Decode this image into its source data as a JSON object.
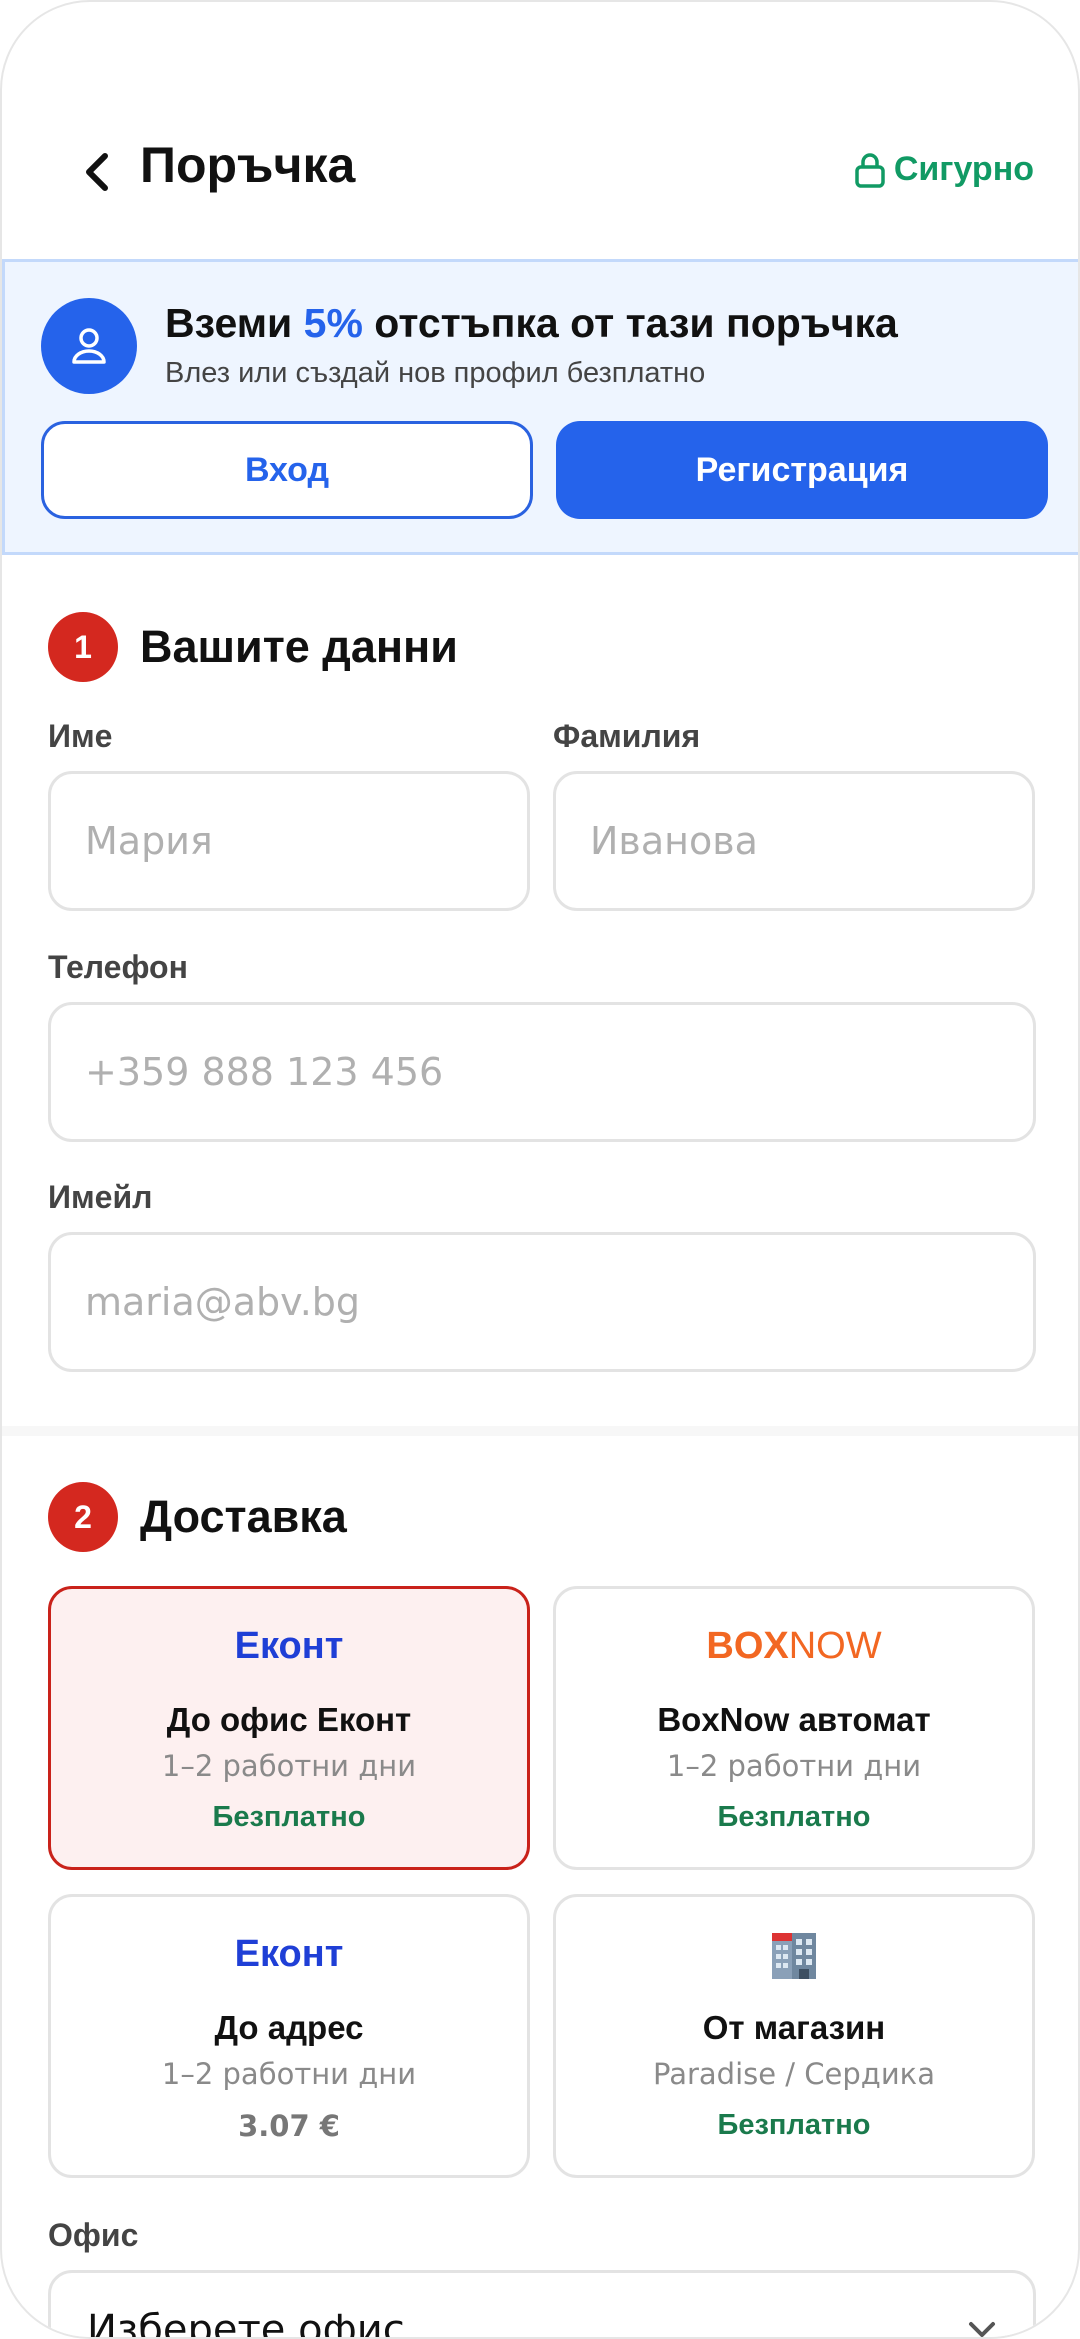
{
  "header": {
    "title": "Поръчка",
    "secure_label": "Сигурно"
  },
  "promo": {
    "title_before": "Вземи ",
    "title_accent": "5%",
    "title_after": " отстъпка от тази поръчка",
    "subtitle": "Влез или създай нов профил безплатно",
    "login_label": "Вход",
    "register_label": "Регистрация"
  },
  "personal": {
    "step": "1",
    "title": "Вашите данни",
    "first_name_label": "Име",
    "first_name_placeholder": "Мария",
    "last_name_label": "Фамилия",
    "last_name_placeholder": "Иванова",
    "phone_label": "Телефон",
    "phone_placeholder": "+359 888 123 456",
    "email_label": "Имейл",
    "email_placeholder": "maria@abv.bg"
  },
  "delivery": {
    "step": "2",
    "title": "Доставка",
    "options": [
      {
        "logo": "Еконт",
        "name": "До офис Еконт",
        "time": "1–2 работни дни",
        "price": "Безплатно"
      },
      {
        "logo_box": "BOX",
        "logo_now": "NOW",
        "name": "BoxNow автомат",
        "time": "1–2 работни дни",
        "price": "Безплатно"
      },
      {
        "logo": "Еконт",
        "name": "До адрес",
        "time": "1–2 работни дни",
        "price": "3.07 €"
      },
      {
        "icon": "building-icon",
        "name": "От магазин",
        "time": "Paradise / Сердика",
        "price": "Безплатно"
      }
    ],
    "office_label": "Офис",
    "office_placeholder": "Изберете офис"
  },
  "colors": {
    "primary": "#2563eb",
    "step_badge": "#d4281f",
    "secure": "#119a64",
    "free": "#1a7a4c",
    "boxnow": "#f26722"
  }
}
